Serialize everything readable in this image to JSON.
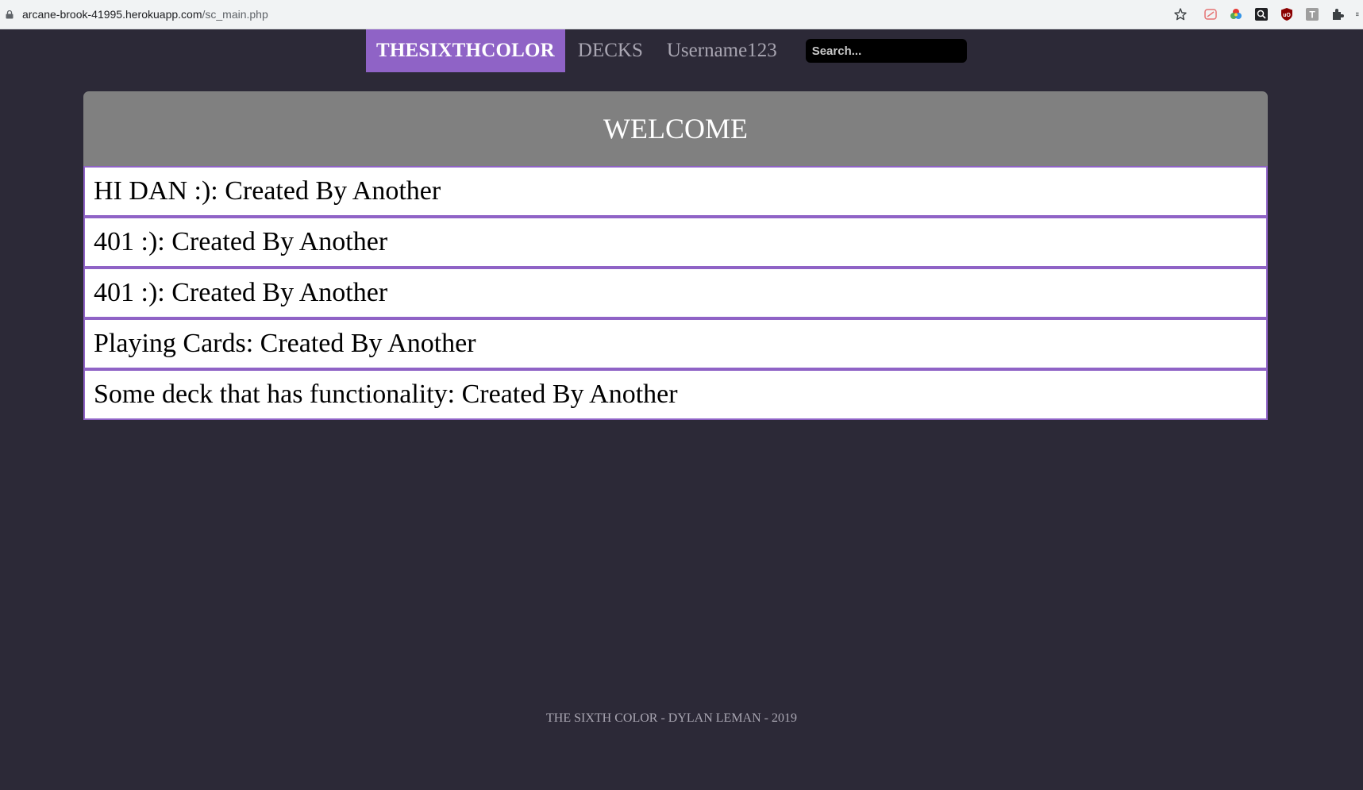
{
  "browser": {
    "url_host": "arcane-brook-41995.herokuapp.com",
    "url_path": "/sc_main.php",
    "icons": [
      "lock-icon",
      "star-icon",
      "adblock-icon",
      "color-picker-icon",
      "search-ext-icon",
      "ublock-icon",
      "t-ext-icon",
      "puzzle-icon"
    ]
  },
  "nav": {
    "brand": "THESIXTHCOLOR",
    "decks": "DECKS",
    "username": "Username123",
    "search_placeholder": "Search..."
  },
  "main": {
    "title": "WELCOME",
    "decks": [
      {
        "label": "HI DAN :): Created By Another"
      },
      {
        "label": "401 :): Created By Another"
      },
      {
        "label": "401 :): Created By Another"
      },
      {
        "label": "Playing Cards: Created By Another"
      },
      {
        "label": "Some deck that has functionality: Created By Another"
      }
    ]
  },
  "footer": {
    "text": "THE SIXTH COLOR - DYLAN LEMAN - 2019"
  },
  "colors": {
    "background": "#2c2937",
    "accent": "#8f63c6",
    "panel_header": "#808080",
    "nav_text": "#a9a6b2"
  }
}
